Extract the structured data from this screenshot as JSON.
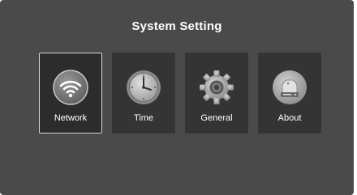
{
  "screen": {
    "title": "System Setting"
  },
  "menu": {
    "items": [
      {
        "id": "network",
        "label": "Network",
        "icon": "wifi-icon",
        "selected": true
      },
      {
        "id": "time",
        "label": "Time",
        "icon": "clock-icon",
        "selected": false
      },
      {
        "id": "general",
        "label": "General",
        "icon": "gear-icon",
        "selected": false
      },
      {
        "id": "about",
        "label": "About",
        "icon": "hard-drive-icon",
        "selected": false
      }
    ]
  },
  "colors": {
    "background": "#4a4a4a",
    "tile": "#343434",
    "selected_border": "#d8d8d8",
    "text": "#ffffff"
  }
}
